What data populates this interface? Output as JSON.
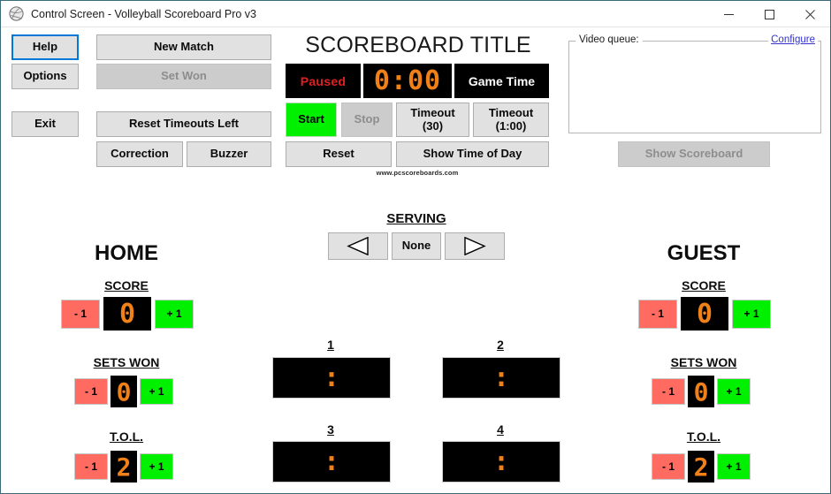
{
  "window": {
    "title": "Control Screen - Volleyball Scoreboard Pro v3",
    "icon": "volleyball-icon",
    "minimize": "—",
    "maximize": "☐",
    "close": "✕"
  },
  "left_panel": {
    "help": "Help",
    "options": "Options",
    "exit": "Exit",
    "new_match": "New Match",
    "set_won": "Set Won",
    "reset_timeouts_left": "Reset Timeouts Left",
    "correction": "Correction",
    "buzzer": "Buzzer"
  },
  "clock_panel": {
    "title": "SCOREBOARD TITLE",
    "status": "Paused",
    "time": "0:00",
    "time_label": "Game Time",
    "start": "Start",
    "stop": "Stop",
    "timeout_30": "Timeout\n(30)",
    "timeout_30_line1": "Timeout",
    "timeout_30_line2": "(30)",
    "timeout_60_line1": "Timeout",
    "timeout_60_line2": "(1:00)",
    "reset": "Reset",
    "show_time_of_day": "Show Time of Day",
    "watermark": "www.pcscoreboards.com"
  },
  "video_panel": {
    "legend": "Video queue:",
    "configure": "Configure",
    "show_scoreboard": "Show Scoreboard"
  },
  "serving": {
    "title": "SERVING",
    "left_icon": "triangle-left-icon",
    "none": "None",
    "right_icon": "triangle-right-icon",
    "selected": "None"
  },
  "home": {
    "name": "HOME",
    "score_label": "SCORE",
    "score_value": "0",
    "sets_label": "SETS WON",
    "sets_value": "0",
    "tol_label": "T.O.L.",
    "tol_value": "2",
    "minus": "- 1",
    "plus": "+ 1"
  },
  "guest": {
    "name": "GUEST",
    "score_label": "SCORE",
    "score_value": "0",
    "sets_label": "SETS WON",
    "sets_value": "0",
    "tol_label": "T.O.L.",
    "tol_value": "2",
    "minus": "- 1",
    "plus": "+ 1"
  },
  "sets": [
    {
      "label": "1",
      "value": ":"
    },
    {
      "label": "2",
      "value": ":"
    },
    {
      "label": "3",
      "value": ":"
    },
    {
      "label": "4",
      "value": ":"
    }
  ],
  "colors": {
    "led_orange": "#f08018",
    "led_background": "#000000",
    "paused_red": "#e02020",
    "minus_red": "#ff6b60",
    "plus_green": "#00f000",
    "link_blue": "#3333cc",
    "focus_blue": "#0078d7",
    "button_face": "#e1e1e1",
    "disabled_face": "#cccccc"
  }
}
